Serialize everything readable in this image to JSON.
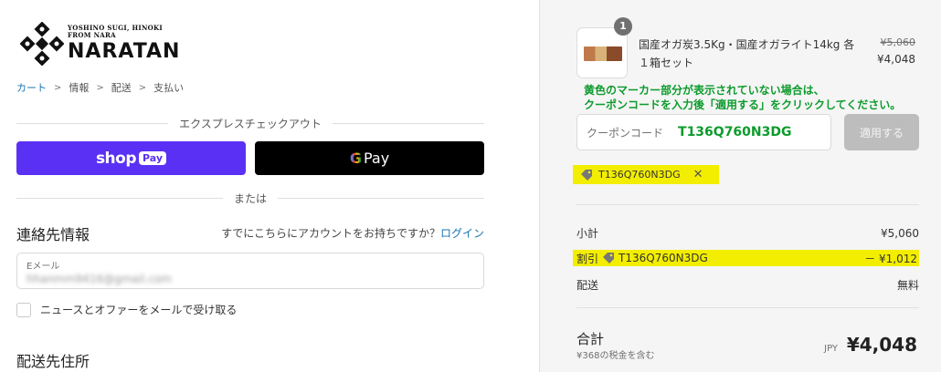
{
  "brand": {
    "tagline_line1": "YOSHINO SUGI, HINOKI",
    "tagline_line2": "FROM NARA",
    "name": "NARATAN"
  },
  "breadcrumb": {
    "items": [
      "カート",
      "情報",
      "配送",
      "支払い"
    ],
    "separator": ">"
  },
  "express": {
    "heading": "エクスプレスチェックアウト",
    "shop_label": "shop",
    "shop_badge": "Pay",
    "gpay_g": "G",
    "gpay_label": "Pay",
    "or_text": "または"
  },
  "contact": {
    "title": "連絡先情報",
    "account_prompt": "すでにこちらにアカウントをお持ちですか？",
    "login_link": "ログイン",
    "email_label": "Eメール",
    "email_value": "hhanmm9416@gmail.com",
    "newsletter_label": "ニュースとオファーをメールで受け取る"
  },
  "shipping": {
    "title": "配送先住所"
  },
  "summary": {
    "quantity": "1",
    "product_name": "国産オガ炭3.5Kg・国産オガライト14kg 各１箱セット",
    "old_price": "¥5,060",
    "price": "¥4,048",
    "notice_line1": "黄色のマーカー部分が表示されていない場合は、",
    "notice_line2": "クーポンコードを入力後「適用する」をクリックしてください。",
    "coupon_placeholder": "クーポンコード",
    "coupon_value": "T136Q760N3DG",
    "apply_label": "適用する",
    "applied_code": "T136Q760N3DG",
    "subtotal_label": "小計",
    "subtotal_value": "¥5,060",
    "discount_label": "割引",
    "discount_code": "T136Q760N3DG",
    "discount_value": "－ ¥1,012",
    "shipping_label": "配送",
    "shipping_value": "無料",
    "total_label": "合計",
    "tax_note": "¥368の税金を含む",
    "currency": "JPY",
    "total_value": "¥4,048"
  },
  "colors": {
    "shop_pay": "#5a31f4",
    "link": "#1773b0",
    "highlight": "#f3ee00",
    "notice_green": "#0d9b2c"
  }
}
